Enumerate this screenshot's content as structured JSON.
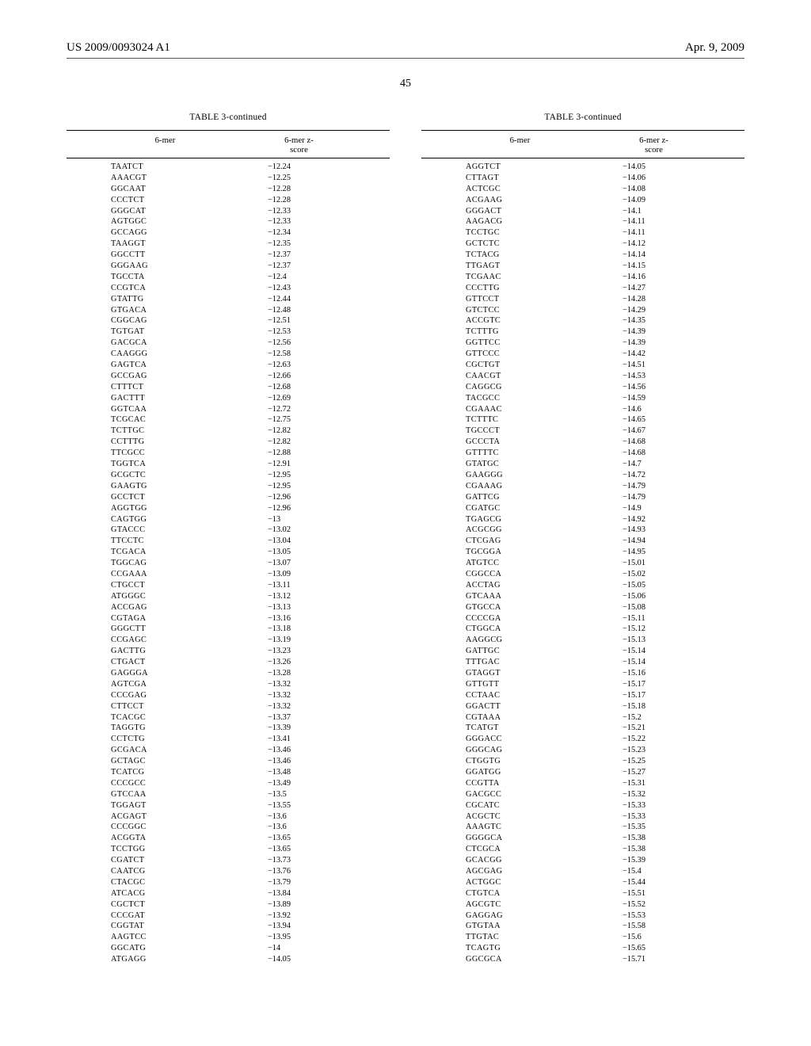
{
  "header": {
    "pubnum": "US 2009/0093024 A1",
    "date": "Apr. 9, 2009"
  },
  "page_number": "45",
  "tables": {
    "left": {
      "title": "TABLE 3-continued",
      "col1": "6-mer",
      "col2_top": "6-mer z-",
      "col2_bot": "score",
      "rows": [
        {
          "m": "TAATCT",
          "z": "−12.24"
        },
        {
          "m": "AAACGT",
          "z": "−12.25"
        },
        {
          "m": "GGCAAT",
          "z": "−12.28"
        },
        {
          "m": "CCCTCT",
          "z": "−12.28"
        },
        {
          "m": "GGGCAT",
          "z": "−12.33"
        },
        {
          "m": "AGTGGC",
          "z": "−12.33"
        },
        {
          "m": "GCCAGG",
          "z": "−12.34"
        },
        {
          "m": "TAAGGT",
          "z": "−12.35"
        },
        {
          "m": "GGCCTT",
          "z": "−12.37"
        },
        {
          "m": "GGGAAG",
          "z": "−12.37"
        },
        {
          "m": "TGCCTA",
          "z": "−12.4"
        },
        {
          "m": "CCGTCA",
          "z": "−12.43"
        },
        {
          "m": "GTATTG",
          "z": "−12.44"
        },
        {
          "m": "GTGACA",
          "z": "−12.48"
        },
        {
          "m": "CGGCAG",
          "z": "−12.51"
        },
        {
          "m": "TGTGAT",
          "z": "−12.53"
        },
        {
          "m": "GACGCA",
          "z": "−12.56"
        },
        {
          "m": "CAAGGG",
          "z": "−12.58"
        },
        {
          "m": "GAGTCA",
          "z": "−12.63"
        },
        {
          "m": "GCCGAG",
          "z": "−12.66"
        },
        {
          "m": "CTTTCT",
          "z": "−12.68"
        },
        {
          "m": "GACTTT",
          "z": "−12.69"
        },
        {
          "m": "GGTCAA",
          "z": "−12.72"
        },
        {
          "m": "TCGCAC",
          "z": "−12.75"
        },
        {
          "m": "TCTTGC",
          "z": "−12.82"
        },
        {
          "m": "CCTTTG",
          "z": "−12.82"
        },
        {
          "m": "TTCGCC",
          "z": "−12.88"
        },
        {
          "m": "TGGTCA",
          "z": "−12.91"
        },
        {
          "m": "GCGCTC",
          "z": "−12.95"
        },
        {
          "m": "GAAGTG",
          "z": "−12.95"
        },
        {
          "m": "GCCTCT",
          "z": "−12.96"
        },
        {
          "m": "AGGTGG",
          "z": "−12.96"
        },
        {
          "m": "CAGTGG",
          "z": "−13"
        },
        {
          "m": "GTACCC",
          "z": "−13.02"
        },
        {
          "m": "TTCCTC",
          "z": "−13.04"
        },
        {
          "m": "TCGACA",
          "z": "−13.05"
        },
        {
          "m": "TGGCAG",
          "z": "−13.07"
        },
        {
          "m": "CCGAAA",
          "z": "−13.09"
        },
        {
          "m": "CTGCCT",
          "z": "−13.11"
        },
        {
          "m": "ATGGGC",
          "z": "−13.12"
        },
        {
          "m": "ACCGAG",
          "z": "−13.13"
        },
        {
          "m": "CGTAGA",
          "z": "−13.16"
        },
        {
          "m": "GGGCTT",
          "z": "−13.18"
        },
        {
          "m": "CCGAGC",
          "z": "−13.19"
        },
        {
          "m": "GACTTG",
          "z": "−13.23"
        },
        {
          "m": "CTGACT",
          "z": "−13.26"
        },
        {
          "m": "GAGGGA",
          "z": "−13.28"
        },
        {
          "m": "AGTCGA",
          "z": "−13.32"
        },
        {
          "m": "CCCGAG",
          "z": "−13.32"
        },
        {
          "m": "CTTCCT",
          "z": "−13.32"
        },
        {
          "m": "TCACGC",
          "z": "−13.37"
        },
        {
          "m": "TAGGTG",
          "z": "−13.39"
        },
        {
          "m": "CCTCTG",
          "z": "−13.41"
        },
        {
          "m": "GCGACA",
          "z": "−13.46"
        },
        {
          "m": "GCTAGC",
          "z": "−13.46"
        },
        {
          "m": "TCATCG",
          "z": "−13.48"
        },
        {
          "m": "CCCGCC",
          "z": "−13.49"
        },
        {
          "m": "GTCCAA",
          "z": "−13.5"
        },
        {
          "m": "TGGAGT",
          "z": "−13.55"
        },
        {
          "m": "ACGAGT",
          "z": "−13.6"
        },
        {
          "m": "CCCGGC",
          "z": "−13.6"
        },
        {
          "m": "ACGGTA",
          "z": "−13.65"
        },
        {
          "m": "TCCTGG",
          "z": "−13.65"
        },
        {
          "m": "CGATCT",
          "z": "−13.73"
        },
        {
          "m": "CAATCG",
          "z": "−13.76"
        },
        {
          "m": "CTACGC",
          "z": "−13.79"
        },
        {
          "m": "ATCACG",
          "z": "−13.84"
        },
        {
          "m": "CGCTCT",
          "z": "−13.89"
        },
        {
          "m": "CCCGAT",
          "z": "−13.92"
        },
        {
          "m": "CGGTAT",
          "z": "−13.94"
        },
        {
          "m": "AAGTCC",
          "z": "−13.95"
        },
        {
          "m": "GGCATG",
          "z": "−14"
        },
        {
          "m": "ATGAGG",
          "z": "−14.05"
        }
      ]
    },
    "right": {
      "title": "TABLE 3-continued",
      "col1": "6-mer",
      "col2_top": "6-mer z-",
      "col2_bot": "score",
      "rows": [
        {
          "m": "AGGTCT",
          "z": "−14.05"
        },
        {
          "m": "CTTAGT",
          "z": "−14.06"
        },
        {
          "m": "ACTCGC",
          "z": "−14.08"
        },
        {
          "m": "ACGAAG",
          "z": "−14.09"
        },
        {
          "m": "GGGACT",
          "z": "−14.1"
        },
        {
          "m": "AAGACG",
          "z": "−14.11"
        },
        {
          "m": "TCCTGC",
          "z": "−14.11"
        },
        {
          "m": "GCTCTC",
          "z": "−14.12"
        },
        {
          "m": "TCTACG",
          "z": "−14.14"
        },
        {
          "m": "TTGAGT",
          "z": "−14.15"
        },
        {
          "m": "TCGAAC",
          "z": "−14.16"
        },
        {
          "m": "CCCTTG",
          "z": "−14.27"
        },
        {
          "m": "GTTCCT",
          "z": "−14.28"
        },
        {
          "m": "GTCTCC",
          "z": "−14.29"
        },
        {
          "m": "ACCGTC",
          "z": "−14.35"
        },
        {
          "m": "TCTTTG",
          "z": "−14.39"
        },
        {
          "m": "GGTTCC",
          "z": "−14.39"
        },
        {
          "m": "GTTCCC",
          "z": "−14.42"
        },
        {
          "m": "CGCTGT",
          "z": "−14.51"
        },
        {
          "m": "CAACGT",
          "z": "−14.53"
        },
        {
          "m": "CAGGCG",
          "z": "−14.56"
        },
        {
          "m": "TACGCC",
          "z": "−14.59"
        },
        {
          "m": "CGAAAC",
          "z": "−14.6"
        },
        {
          "m": "TCTTTC",
          "z": "−14.65"
        },
        {
          "m": "TGCCCT",
          "z": "−14.67"
        },
        {
          "m": "GCCCTA",
          "z": "−14.68"
        },
        {
          "m": "GTTTTC",
          "z": "−14.68"
        },
        {
          "m": "GTATGC",
          "z": "−14.7"
        },
        {
          "m": "GAAGGG",
          "z": "−14.72"
        },
        {
          "m": "CGAAAG",
          "z": "−14.79"
        },
        {
          "m": "GATTCG",
          "z": "−14.79"
        },
        {
          "m": "CGATGC",
          "z": "−14.9"
        },
        {
          "m": "TGAGCG",
          "z": "−14.92"
        },
        {
          "m": "ACGCGG",
          "z": "−14.93"
        },
        {
          "m": "CTCGAG",
          "z": "−14.94"
        },
        {
          "m": "TGCGGA",
          "z": "−14.95"
        },
        {
          "m": "ATGTCC",
          "z": "−15.01"
        },
        {
          "m": "CGGCCA",
          "z": "−15.02"
        },
        {
          "m": "ACCTAG",
          "z": "−15.05"
        },
        {
          "m": "GTCAAA",
          "z": "−15.06"
        },
        {
          "m": "GTGCCA",
          "z": "−15.08"
        },
        {
          "m": "CCCCGA",
          "z": "−15.11"
        },
        {
          "m": "CTGGCA",
          "z": "−15.12"
        },
        {
          "m": "AAGGCG",
          "z": "−15.13"
        },
        {
          "m": "GATTGC",
          "z": "−15.14"
        },
        {
          "m": "TTTGAC",
          "z": "−15.14"
        },
        {
          "m": "GTAGGT",
          "z": "−15.16"
        },
        {
          "m": "GTTGTT",
          "z": "−15.17"
        },
        {
          "m": "CCTAAC",
          "z": "−15.17"
        },
        {
          "m": "GGACTT",
          "z": "−15.18"
        },
        {
          "m": "CGTAAA",
          "z": "−15.2"
        },
        {
          "m": "TCATGT",
          "z": "−15.21"
        },
        {
          "m": "GGGACC",
          "z": "−15.22"
        },
        {
          "m": "GGGCAG",
          "z": "−15.23"
        },
        {
          "m": "CTGGTG",
          "z": "−15.25"
        },
        {
          "m": "GGATGG",
          "z": "−15.27"
        },
        {
          "m": "CCGTTA",
          "z": "−15.31"
        },
        {
          "m": "GACGCC",
          "z": "−15.32"
        },
        {
          "m": "CGCATC",
          "z": "−15.33"
        },
        {
          "m": "ACGCTC",
          "z": "−15.33"
        },
        {
          "m": "AAAGTC",
          "z": "−15.35"
        },
        {
          "m": "GGGGCA",
          "z": "−15.38"
        },
        {
          "m": "CTCGCA",
          "z": "−15.38"
        },
        {
          "m": "GCACGG",
          "z": "−15.39"
        },
        {
          "m": "AGCGAG",
          "z": "−15.4"
        },
        {
          "m": "ACTGGC",
          "z": "−15.44"
        },
        {
          "m": "CTGTCA",
          "z": "−15.51"
        },
        {
          "m": "AGCGTC",
          "z": "−15.52"
        },
        {
          "m": "GAGGAG",
          "z": "−15.53"
        },
        {
          "m": "GTGTAA",
          "z": "−15.58"
        },
        {
          "m": "TTGTAC",
          "z": "−15.6"
        },
        {
          "m": "TCAGTG",
          "z": "−15.65"
        },
        {
          "m": "GGCGCA",
          "z": "−15.71"
        }
      ]
    }
  }
}
